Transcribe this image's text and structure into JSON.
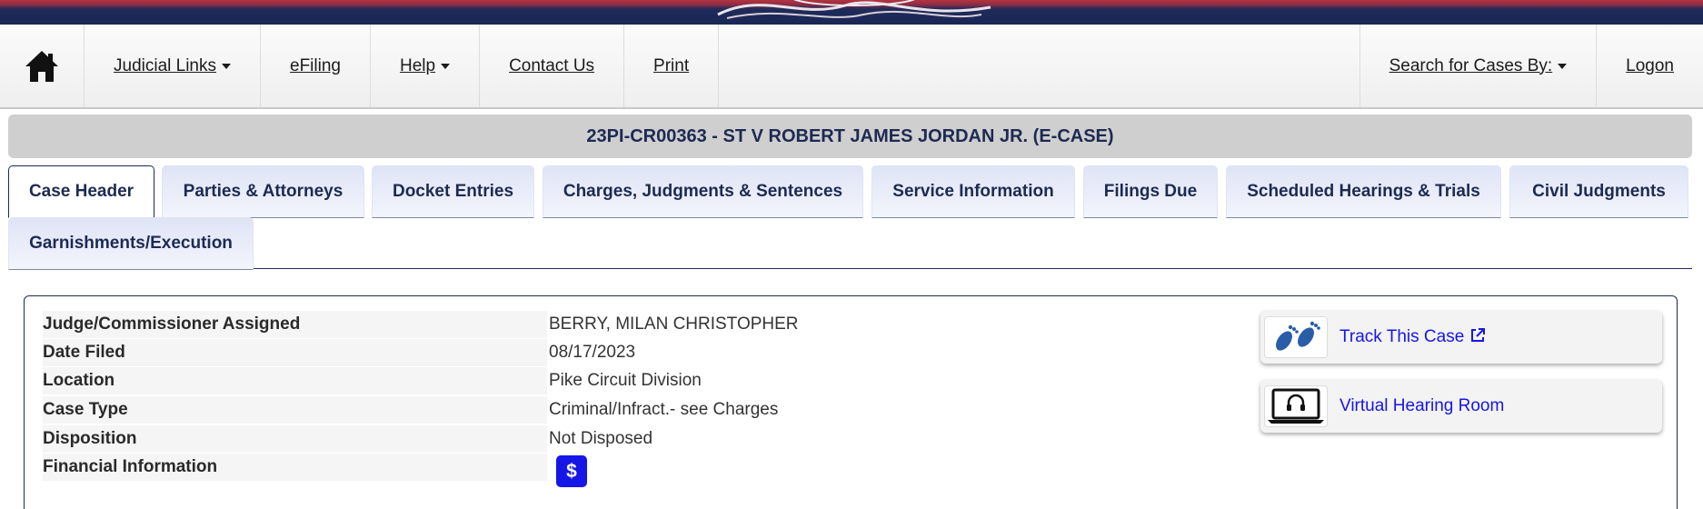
{
  "nav": {
    "judicial_links": "Judicial Links",
    "efiling": "eFiling",
    "help": "Help",
    "contact_us": "Contact Us",
    "print": "Print",
    "search_by": "Search for Cases By:",
    "logon": "Logon"
  },
  "case": {
    "title": "23PI-CR00363 - ST V ROBERT JAMES JORDAN JR. (E-CASE)"
  },
  "tabs": [
    {
      "label": "Case Header",
      "active": true
    },
    {
      "label": "Parties & Attorneys"
    },
    {
      "label": "Docket Entries"
    },
    {
      "label": "Charges, Judgments & Sentences"
    },
    {
      "label": "Service Information"
    },
    {
      "label": "Filings Due"
    },
    {
      "label": "Scheduled Hearings & Trials"
    },
    {
      "label": "Civil Judgments"
    },
    {
      "label": "Garnishments/Execution"
    }
  ],
  "details": [
    {
      "label": "Judge/Commissioner Assigned",
      "value": "BERRY, MILAN CHRISTOPHER"
    },
    {
      "label": "Date Filed",
      "value": "08/17/2023"
    },
    {
      "label": "Location",
      "value": "Pike Circuit Division"
    },
    {
      "label": "Case Type",
      "value": "Criminal/Infract.- see Charges"
    },
    {
      "label": "Disposition",
      "value": "Not Disposed"
    },
    {
      "label": "Financial Information",
      "value": ""
    }
  ],
  "financial_button": {
    "glyph": "$",
    "icon": "dollar-icon",
    "color": "#1616e6"
  },
  "side_actions": {
    "track": {
      "label": "Track This Case",
      "icon": "footprints-icon"
    },
    "virtual": {
      "label": "Virtual Hearing Room",
      "icon": "laptop-headphones-icon"
    }
  },
  "colors": {
    "navy": "#1d2a52",
    "link_blue": "#1616e6",
    "title_bar": "#cfcfcf"
  }
}
